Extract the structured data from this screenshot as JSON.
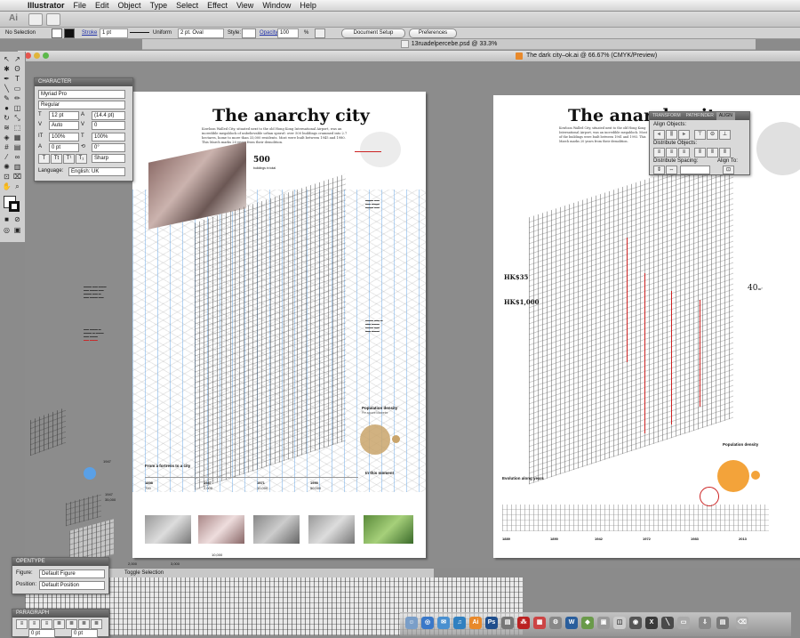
{
  "menubar": {
    "apple_icon": "apple-icon",
    "items": [
      "Illustrator",
      "File",
      "Edit",
      "Object",
      "Type",
      "Select",
      "Effect",
      "View",
      "Window",
      "Help"
    ]
  },
  "appbar": {
    "logo": "Ai"
  },
  "controlbar": {
    "selection": "No Selection",
    "stroke_label": "Stroke",
    "stroke_weight": "1 pt",
    "uniform": "Uniform",
    "brush": "2 pt. Oval",
    "style_label": "Style:",
    "opacity_label": "Opacity",
    "opacity_value": "100",
    "percent": "%",
    "document_setup": "Document Setup",
    "preferences": "Preferences"
  },
  "tabs": {
    "doc1": "13ruadelpercebe.psd @ 33.3%",
    "doc2": "The dark city–ok.ai @ 66.67% (CMYK/Preview)"
  },
  "artboard1": {
    "title": "The anarchy city",
    "intro": "Kowloon Walled City, situated next to the old Hong Kong International Airport, was an incredible megablock of unbelievable urban sprawl: over 500 buildings crammed into 2.7 hectares, home to more than 33,000 residents. Most were built between 1945 and 1980. This March marks 20 years from their demolition.",
    "stat_500": "500",
    "stat_500_label": "buildings in total",
    "population_density": "Population density",
    "per_square_kilometre": "Per square kilometre",
    "timeline_title": "From a fortress to a city",
    "timeline_years": [
      "1898",
      "1947",
      "1971",
      "1990"
    ],
    "timeline_values": [
      "700",
      "2,000",
      "10,000",
      "50,000"
    ],
    "in_this_moment": "In this moment",
    "axis_2000": "2,000",
    "axis_3000": "3,000",
    "axis_10000": "10,000",
    "left_year": "1947",
    "left_value": "35,000"
  },
  "artboard2": {
    "title": "The anarchy city",
    "intro": "Kowloon Walled City, situated next to the old Hong Kong International Airport, was an incredible megablock. Most of the buildings were built between 1961 and 1993. This March marks 20 years from their demolition.",
    "price_1": "HK$35",
    "price_2": "HK$1,000",
    "stat_40": "40",
    "stat_40_unit": "m²",
    "population_density": "Population density",
    "evolution": "Evolution along years",
    "years": [
      "1889",
      "1890",
      "1942",
      "1972",
      "1983",
      "2013"
    ]
  },
  "character_panel": {
    "title": "CHARACTER",
    "font": "Myriad Pro",
    "style": "Regular",
    "size": "12 pt",
    "leading": "(14.4 pt)",
    "kerning": "Auto",
    "tracking": "0",
    "vscale": "100%",
    "hscale": "100%",
    "baseline": "0 pt",
    "rotation": "0°",
    "antialias": "Sharp",
    "language_label": "Language:",
    "language": "English: UK"
  },
  "align_panel": {
    "tabs": [
      "TRANSFORM",
      "PATHFINDER",
      "ALIGN"
    ],
    "align_objects": "Align Objects:",
    "distribute_objects": "Distribute Objects:",
    "distribute_spacing": "Distribute Spacing:",
    "align_to": "Align To:"
  },
  "opentype_panel": {
    "title": "OPENTYPE",
    "figure_label": "Figure:",
    "figure_value": "Default Figure",
    "position_label": "Position:",
    "position_value": "Default Position"
  },
  "paragraph_panel": {
    "title": "PARAGRAPH",
    "indent_value": "0 pt",
    "space_value": "0 pt"
  },
  "status": {
    "toggle": "Toggle Selection"
  },
  "colors": {
    "accent_blue": "#5aa0e6",
    "density_orange": "#f3a33a",
    "density_brown": "#c9a46b",
    "red_sketch": "#cc2222"
  }
}
